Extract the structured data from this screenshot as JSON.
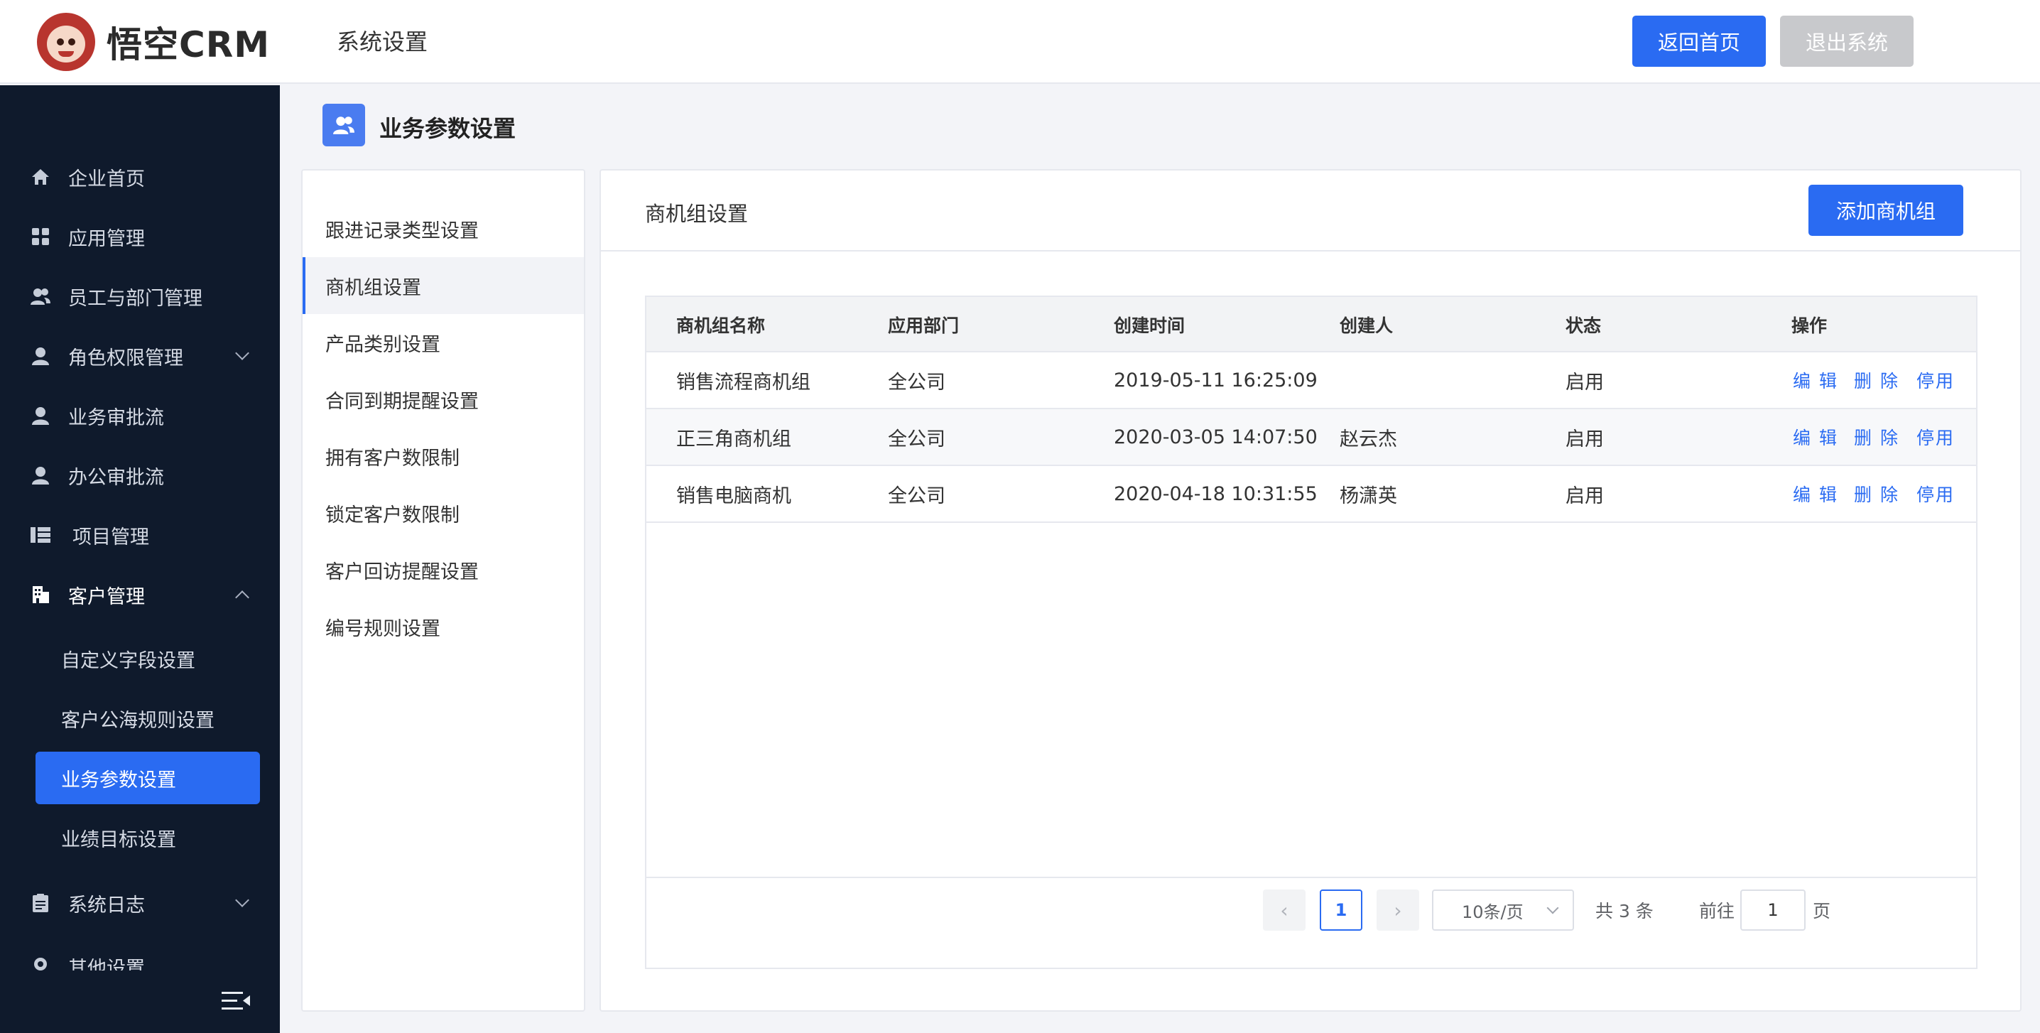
{
  "header": {
    "logo_text": "悟空CRM",
    "title": "系统设置",
    "home_button": "返回首页",
    "logout_button": "退出系统"
  },
  "sidebar": {
    "items": [
      {
        "label": "企业首页",
        "icon": "home-icon"
      },
      {
        "label": "应用管理",
        "icon": "apps-icon"
      },
      {
        "label": "员工与部门管理",
        "icon": "users-icon"
      },
      {
        "label": "角色权限管理",
        "icon": "role-icon"
      },
      {
        "label": "业务审批流",
        "icon": "person-icon"
      },
      {
        "label": "办公审批流",
        "icon": "person-icon"
      },
      {
        "label": "项目管理",
        "icon": "project-icon"
      },
      {
        "label": "客户管理",
        "icon": "building-icon"
      }
    ],
    "sub_items": [
      "自定义字段设置",
      "客户公海规则设置",
      "业务参数设置",
      "业绩目标设置"
    ],
    "bottom_items": [
      {
        "label": "系统日志",
        "icon": "log-icon"
      },
      {
        "label": "其他设置",
        "icon": "settings-icon"
      }
    ]
  },
  "page": {
    "title": "业务参数设置",
    "title_icon": "users-icon"
  },
  "menu": {
    "items": [
      "跟进记录类型设置",
      "商机组设置",
      "产品类别设置",
      "合同到期提醒设置",
      "拥有客户数限制",
      "锁定客户数限制",
      "客户回访提醒设置",
      "编号规则设置"
    ],
    "active": "商机组设置"
  },
  "main": {
    "title": "商机组设置",
    "add_button": "添加商机组",
    "table": {
      "headers": [
        "商机组名称",
        "应用部门",
        "创建时间",
        "创建人",
        "状态",
        "操作"
      ],
      "rows": [
        {
          "name": "销售流程商机组",
          "dept": "全公司",
          "created": "2019-05-11 16:25:09",
          "creator": "",
          "status": "启用"
        },
        {
          "name": "正三角商机组",
          "dept": "全公司",
          "created": "2020-03-05 14:07:50",
          "creator": "赵云杰",
          "status": "启用"
        },
        {
          "name": "销售电脑商机",
          "dept": "全公司",
          "created": "2020-04-18 10:31:55",
          "creator": "杨潇英",
          "status": "启用"
        }
      ],
      "actions": {
        "edit": "编 辑",
        "delete": "删 除",
        "disable": "停用"
      }
    },
    "pagination": {
      "prev": "‹",
      "page": "1",
      "next": "›",
      "page_size": "10条/页",
      "total": "共 3 条",
      "goto_label": "前往",
      "goto_value": "1",
      "goto_suffix": "页"
    }
  },
  "colors": {
    "accent": "#2a6bf2",
    "sidebar_bg": "#0f1a2c",
    "disabled_button": "#c8c9cc"
  }
}
